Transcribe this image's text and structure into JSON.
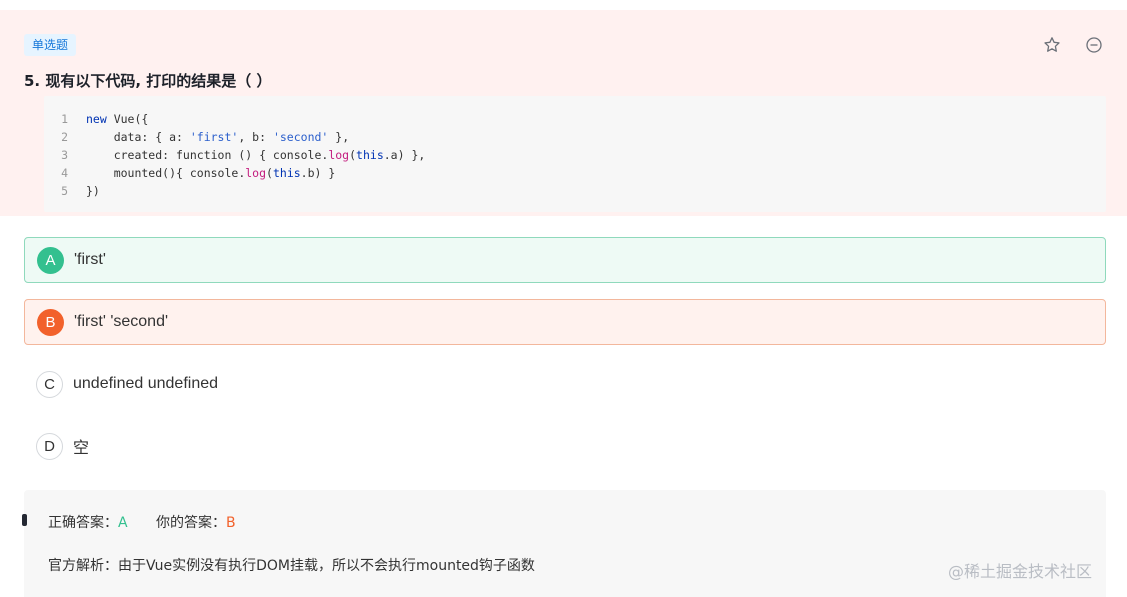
{
  "question": {
    "type_badge": "单选题",
    "title": "5. 现有以下代码, 打印的结果是（  ）",
    "icons": {
      "favorite": "star-icon",
      "collapse": "minus-circle-icon"
    },
    "code_lines": [
      {
        "num": "1",
        "tokens": [
          {
            "t": "new",
            "c": "kw"
          },
          {
            "t": " Vue({",
            "c": "code"
          }
        ]
      },
      {
        "num": "2",
        "tokens": [
          {
            "t": "    data: { a: ",
            "c": "code"
          },
          {
            "t": "'first'",
            "c": "str2"
          },
          {
            "t": ", b: ",
            "c": "code"
          },
          {
            "t": "'second'",
            "c": "str2"
          },
          {
            "t": " },",
            "c": "code"
          }
        ]
      },
      {
        "num": "3",
        "tokens": [
          {
            "t": "    created: function () { console.",
            "c": "code"
          },
          {
            "t": "log",
            "c": "fn"
          },
          {
            "t": "(",
            "c": "code"
          },
          {
            "t": "this",
            "c": "th"
          },
          {
            "t": ".a) },",
            "c": "code"
          }
        ]
      },
      {
        "num": "4",
        "tokens": [
          {
            "t": "    mounted(){ console.",
            "c": "code"
          },
          {
            "t": "log",
            "c": "fn"
          },
          {
            "t": "(",
            "c": "code"
          },
          {
            "t": "this",
            "c": "th"
          },
          {
            "t": ".b) }",
            "c": "code"
          }
        ]
      },
      {
        "num": "5",
        "tokens": [
          {
            "t": "})",
            "c": "code"
          }
        ]
      }
    ]
  },
  "options": [
    {
      "letter": "A",
      "text": "'first'",
      "state": "correct"
    },
    {
      "letter": "B",
      "text": "'first' 'second'",
      "state": "selected-wrong"
    },
    {
      "letter": "C",
      "text": "undefined undefined",
      "state": "normal"
    },
    {
      "letter": "D",
      "text": "空",
      "state": "normal"
    }
  ],
  "answer": {
    "correct_label": "正确答案：",
    "correct_value": "A",
    "mine_label": "你的答案：",
    "mine_value": "B",
    "analysis": "官方解析：由于Vue实例没有执行DOM挂载，所以不会执行mounted钩子函数"
  },
  "watermark": "@稀土掘金技术社区",
  "colors": {
    "correct": "#33c08f",
    "wrong": "#f2612b",
    "panel_bg": "#fff1f0"
  }
}
